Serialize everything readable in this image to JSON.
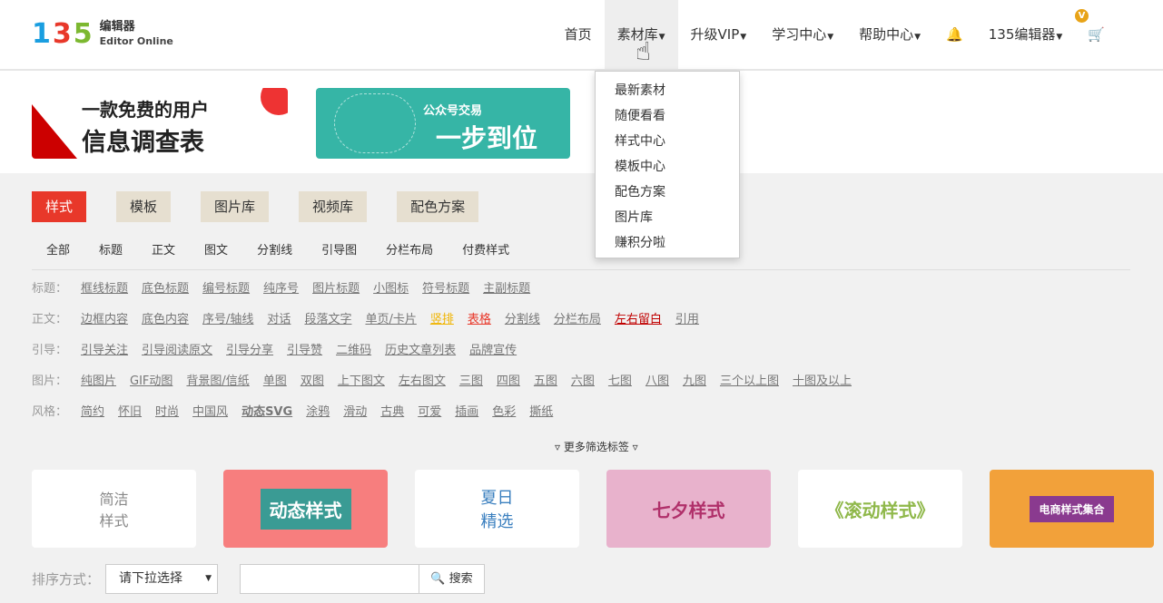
{
  "logo": {
    "mark": "135",
    "cn": "编辑器",
    "en": "Editor Online"
  },
  "nav": [
    {
      "label": "首页"
    },
    {
      "label": "素材库"
    },
    {
      "label": "升级VIP"
    },
    {
      "label": "学习中心"
    },
    {
      "label": "帮助中心"
    },
    {
      "label": "135编辑器"
    }
  ],
  "vip_badge": "V",
  "dropdown": [
    "最新素材",
    "随便看看",
    "样式中心",
    "模板中心",
    "配色方案",
    "图片库",
    "赚积分啦"
  ],
  "banners": [
    {
      "line1": "一款免费的用户",
      "line2": "信息调查表"
    },
    {
      "line1": "公众号交易",
      "line2": "一步到位"
    }
  ],
  "tabs": [
    "样式",
    "模板",
    "图片库",
    "视频库",
    "配色方案"
  ],
  "subtabs": [
    "全部",
    "标题",
    "正文",
    "图文",
    "分割线",
    "引导图",
    "分栏布局",
    "付费样式"
  ],
  "tag_rows": [
    {
      "label": "标题：",
      "tags": [
        "框线标题",
        "底色标题",
        "编号标题",
        "纯序号",
        "图片标题",
        "小图标",
        "符号标题",
        "主副标题"
      ]
    },
    {
      "label": "正文：",
      "tags": [
        "边框内容",
        "底色内容",
        "序号/轴线",
        "对话",
        "段落文字",
        "单页/卡片",
        "竖排",
        "表格",
        "分割线",
        "分栏布局",
        "左右留白",
        "引用"
      ]
    },
    {
      "label": "引导：",
      "tags": [
        "引导关注",
        "引导阅读原文",
        "引导分享",
        "引导赞",
        "二维码",
        "历史文章列表",
        "品牌宣传"
      ]
    },
    {
      "label": "图片：",
      "tags": [
        "纯图片",
        "GIF动图",
        "背景图/信纸",
        "单图",
        "双图",
        "上下图文",
        "左右图文",
        "三图",
        "四图",
        "五图",
        "六图",
        "七图",
        "八图",
        "九图",
        "三个以上图",
        "十图及以上"
      ]
    },
    {
      "label": "风格：",
      "tags": [
        "简约",
        "怀旧",
        "时尚",
        "中国风",
        "动态SVG",
        "涂鸦",
        "滑动",
        "古典",
        "可爱",
        "插画",
        "色彩",
        "撕纸"
      ]
    }
  ],
  "tag_colors": {
    "竖排": "#f0b400",
    "表格": "#e8382a",
    "左右留白": "#c00000"
  },
  "more_filters": "▿ 更多筛选标签 ▿",
  "thumbnails": [
    "简洁\n样式",
    "动态样式",
    "夏日\n精选",
    "七夕样式",
    "《滚动样式》",
    "电商样式集合"
  ],
  "sort": {
    "label": "排序方式：",
    "select": "请下拉选择",
    "search_value": "",
    "search_button": "搜索"
  },
  "colors": {
    "accent": "#e8382a",
    "teal": "#36b5a6"
  }
}
